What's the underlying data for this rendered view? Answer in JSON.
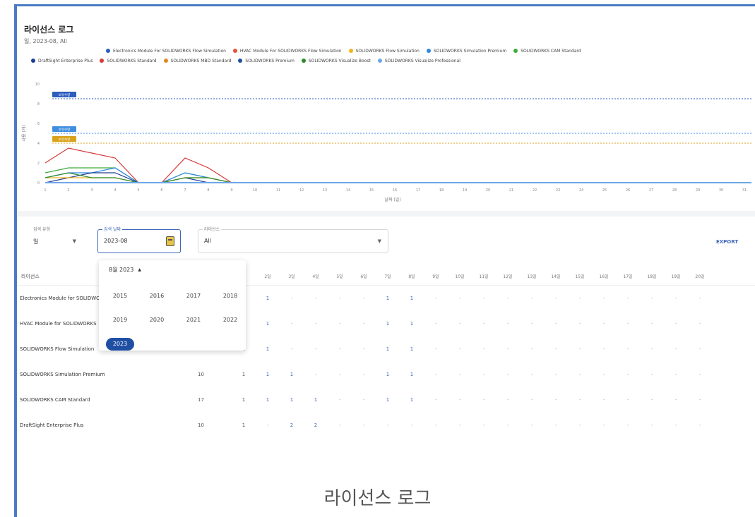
{
  "chart": {
    "title": "라이선스 로그",
    "subtitle": "일, 2023-08, All",
    "legend_row1": [
      {
        "label": "Electronics Module For SOLIDWORKS Flow Simulation",
        "color": "#2c5dbd"
      },
      {
        "label": "HVAC Module For SOLIDWORKS Flow Simulation",
        "color": "#e2533d"
      },
      {
        "label": "SOLIDWORKS Flow Simulation",
        "color": "#f2b51b"
      },
      {
        "label": "SOLIDWORKS Simulation Premium",
        "color": "#2f88e5"
      },
      {
        "label": "SOLIDWORKS CAM Standard",
        "color": "#3daa3a"
      }
    ],
    "legend_row2": [
      {
        "label": "DraftSight Enterprise Plus",
        "color": "#1d3f94"
      },
      {
        "label": "SOLIDWORKS Standard",
        "color": "#d73a3a"
      },
      {
        "label": "SOLIDWORKS MBD Standard",
        "color": "#e08a1c"
      },
      {
        "label": "SOLIDWORKS Premium",
        "color": "#1f4fa3"
      },
      {
        "label": "SOLIDWORKS Visualize Boost",
        "color": "#2b8a2e"
      },
      {
        "label": "SOLIDWORKS Visualize Professional",
        "color": "#6ea7e8"
      }
    ],
    "xlabel": "날짜 (일)",
    "ylabel": "사용 (개)",
    "threshold_badges": [
      {
        "label": "보유수량",
        "color": "#2c5dbd"
      },
      {
        "label": "보유수량",
        "color": "#3f8fe0"
      },
      {
        "label": "보유수량",
        "color": "#d8a21a"
      }
    ]
  },
  "chart_data": {
    "type": "line",
    "x": [
      1,
      2,
      3,
      4,
      5,
      6,
      7,
      8,
      9,
      10,
      11,
      12,
      13,
      14,
      15,
      16,
      17,
      18,
      19,
      20,
      21,
      22,
      23,
      24,
      25,
      26,
      27,
      28,
      29,
      30,
      31
    ],
    "xlabel": "날짜 (일)",
    "ylabel": "사용 (개)",
    "ylim": [
      0,
      10
    ],
    "yticks": [
      0,
      2,
      4,
      6,
      8,
      10
    ],
    "thresholds": [
      {
        "value": 8.5,
        "color": "#2c5dbd"
      },
      {
        "value": 5.0,
        "color": "#3f8fe0"
      },
      {
        "value": 4.0,
        "color": "#d8a21a"
      }
    ],
    "series": [
      {
        "name": "SOLIDWORKS Standard",
        "color": "#d73a3a",
        "values": [
          2,
          3.5,
          3,
          2.5,
          0,
          0,
          2.5,
          1.5,
          0,
          0,
          0,
          0,
          0,
          0,
          0,
          0,
          0,
          0,
          0,
          0,
          0,
          0,
          0,
          0,
          0,
          0,
          0,
          0,
          0,
          0,
          0
        ]
      },
      {
        "name": "SOLIDWORKS CAM Standard",
        "color": "#3daa3a",
        "values": [
          1,
          1.5,
          1.5,
          1.5,
          0,
          0,
          1,
          0.5,
          0,
          0,
          0,
          0,
          0,
          0,
          0,
          0,
          0,
          0,
          0,
          0,
          0,
          0,
          0,
          0,
          0,
          0,
          0,
          0,
          0,
          0,
          0
        ]
      },
      {
        "name": "SOLIDWORKS Simulation Premium",
        "color": "#2f88e5",
        "values": [
          0.5,
          1,
          1,
          1.5,
          0,
          0,
          1,
          0.5,
          0,
          0,
          0,
          0,
          0,
          0,
          0,
          0,
          0,
          0,
          0,
          0,
          0,
          0,
          0,
          0,
          0,
          0,
          0,
          0,
          0,
          0,
          0
        ]
      },
      {
        "name": "DraftSight Enterprise Plus",
        "color": "#1d3f94",
        "values": [
          0,
          0.5,
          1,
          1,
          0,
          0,
          0.5,
          0,
          0,
          0,
          0,
          0,
          0,
          0,
          0,
          0,
          0,
          0,
          0,
          0,
          0,
          0,
          0,
          0,
          0,
          0,
          0,
          0,
          0,
          0,
          0
        ]
      },
      {
        "name": "SOLIDWORKS Flow Simulation",
        "color": "#f2b51b",
        "values": [
          0.5,
          0.5,
          0.5,
          0.5,
          0,
          0,
          0.5,
          0.5,
          0,
          0,
          0,
          0,
          0,
          0,
          0,
          0,
          0,
          0,
          0,
          0,
          0,
          0,
          0,
          0,
          0,
          0,
          0,
          0,
          0,
          0,
          0
        ]
      },
      {
        "name": "SOLIDWORKS Visualize Boost",
        "color": "#2b8a2e",
        "values": [
          0.5,
          1,
          0.5,
          0.5,
          0,
          0,
          0.5,
          0.5,
          0,
          0,
          0,
          0,
          0,
          0,
          0,
          0,
          0,
          0,
          0,
          0,
          0,
          0,
          0,
          0,
          0,
          0,
          0,
          0,
          0,
          0,
          0
        ]
      }
    ]
  },
  "filters": {
    "unit_label": "검색 유형",
    "unit_value": "일",
    "date_label": "검색 날짜",
    "date_value": "2023-08",
    "license_label": "라이선스",
    "license_value": "All",
    "export_label": "EXPORT"
  },
  "popup": {
    "header": "8월 2023",
    "years": [
      "2015",
      "2016",
      "2017",
      "2018",
      "2019",
      "2020",
      "2021",
      "2022",
      "2023"
    ],
    "selected": "2023"
  },
  "table": {
    "license_header": "라이선스",
    "day_headers": [
      "2일",
      "3일",
      "4일",
      "5일",
      "6일",
      "7일",
      "8일",
      "9일",
      "10일",
      "11일",
      "12일",
      "13일",
      "14일",
      "15일",
      "16일",
      "17일",
      "18일",
      "19일",
      "20일"
    ],
    "rows": [
      {
        "name": "Electronics Module for SOLIDWORKS",
        "total": "",
        "cells": [
          "1",
          "-",
          "-",
          "-",
          "-",
          "1",
          "1",
          "-",
          "-",
          "-",
          "-",
          "-",
          "-",
          "-",
          "-",
          "-",
          "-",
          "-",
          "-"
        ]
      },
      {
        "name": "HVAC Module for SOLIDWORKS",
        "total": "",
        "cells": [
          "1",
          "-",
          "-",
          "-",
          "-",
          "1",
          "1",
          "-",
          "-",
          "-",
          "-",
          "-",
          "-",
          "-",
          "-",
          "-",
          "-",
          "-",
          "-"
        ]
      },
      {
        "name": "SOLIDWORKS Flow Simulation",
        "total": "10",
        "cells": [
          "1",
          "-",
          "-",
          "-",
          "-",
          "1",
          "1",
          "-",
          "-",
          "-",
          "-",
          "-",
          "-",
          "-",
          "-",
          "-",
          "-",
          "-",
          "-"
        ]
      },
      {
        "name": "SOLIDWORKS Simulation Premium",
        "total": "10",
        "cells": [
          "1",
          "1",
          "-",
          "-",
          "-",
          "1",
          "1",
          "-",
          "-",
          "-",
          "-",
          "-",
          "-",
          "-",
          "-",
          "-",
          "-",
          "-",
          "-"
        ]
      },
      {
        "name": "SOLIDWORKS CAM Standard",
        "total": "17",
        "cells": [
          "1",
          "1",
          "1",
          "-",
          "-",
          "1",
          "1",
          "-",
          "-",
          "-",
          "-",
          "-",
          "-",
          "-",
          "-",
          "-",
          "-",
          "-",
          "-"
        ]
      },
      {
        "name": "DraftSight Enterprise Plus",
        "total": "10",
        "cells": [
          "-",
          "2",
          "2",
          "-",
          "-",
          "-",
          "-",
          "-",
          "-",
          "-",
          "-",
          "-",
          "-",
          "-",
          "-",
          "-",
          "-",
          "-",
          "-"
        ]
      }
    ],
    "first_col_values": [
      "1",
      "1",
      "1",
      "1",
      "1",
      "1"
    ]
  },
  "caption": "라이선스 로그"
}
